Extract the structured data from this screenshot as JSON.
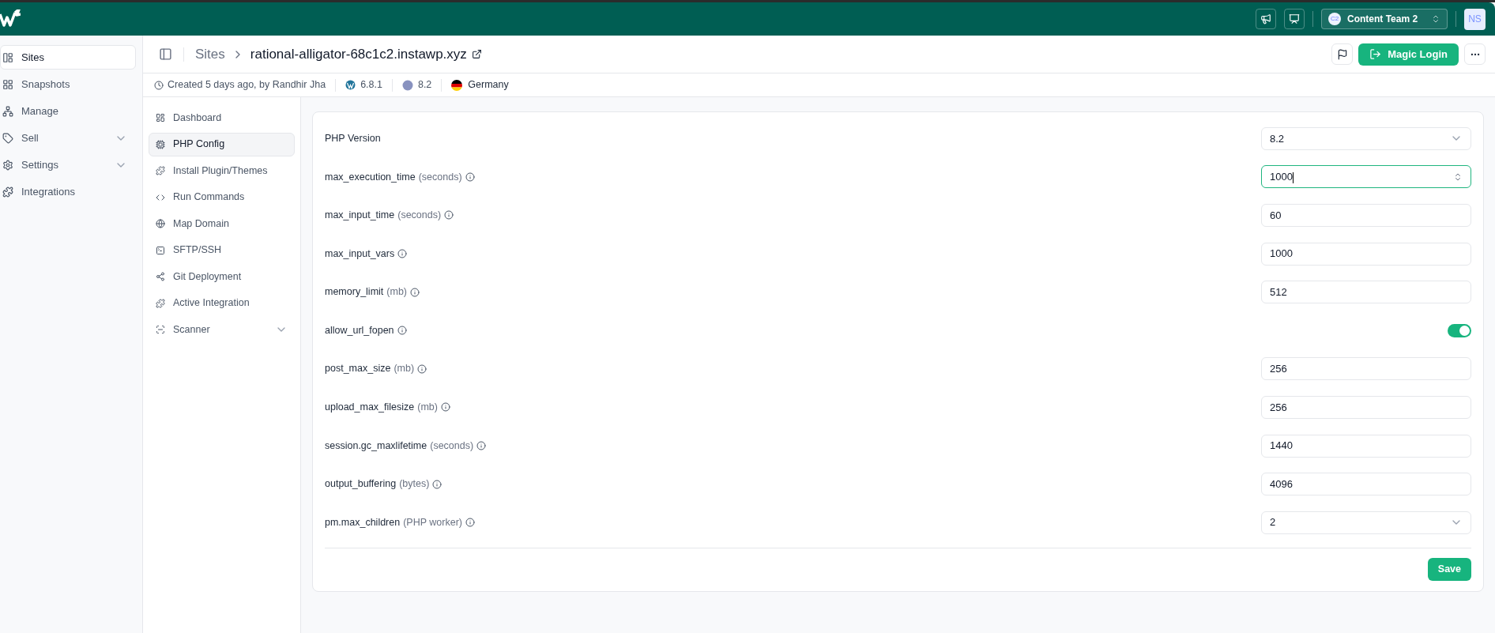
{
  "topbar": {
    "team": {
      "initials": "C2",
      "name": "Content Team 2"
    },
    "avatar": "NS"
  },
  "sidebar": {
    "items": [
      {
        "label": "Sites",
        "selected": true,
        "expandable": false
      },
      {
        "label": "Snapshots",
        "selected": false,
        "expandable": false
      },
      {
        "label": "Manage",
        "selected": false,
        "expandable": false
      },
      {
        "label": "Sell",
        "selected": false,
        "expandable": true
      },
      {
        "label": "Settings",
        "selected": false,
        "expandable": true
      },
      {
        "label": "Integrations",
        "selected": false,
        "expandable": false
      }
    ]
  },
  "header": {
    "breadcrumb": [
      "Sites",
      "rational-alligator-68c1c2.instawp.xyz"
    ],
    "magic_login": "Magic Login"
  },
  "meta": {
    "created": "Created 5 days ago, by Randhir Jha",
    "wp_version": "6.8.1",
    "php_version": "8.2",
    "country": "Germany"
  },
  "subnav": {
    "items": [
      {
        "label": "Dashboard",
        "selected": false,
        "expandable": false
      },
      {
        "label": "PHP Config",
        "selected": true,
        "expandable": false
      },
      {
        "label": "Install Plugin/Themes",
        "selected": false,
        "expandable": false
      },
      {
        "label": "Run Commands",
        "selected": false,
        "expandable": false
      },
      {
        "label": "Map Domain",
        "selected": false,
        "expandable": false
      },
      {
        "label": "SFTP/SSH",
        "selected": false,
        "expandable": false
      },
      {
        "label": "Git Deployment",
        "selected": false,
        "expandable": false
      },
      {
        "label": "Active Integration",
        "selected": false,
        "expandable": false
      },
      {
        "label": "Scanner",
        "selected": false,
        "expandable": true
      }
    ]
  },
  "form": {
    "fields": [
      {
        "kind": "select",
        "name": "PHP Version",
        "value": "8.2",
        "info": false
      },
      {
        "kind": "number",
        "name": "max_execution_time",
        "unit": "(seconds)",
        "value": "1000",
        "info": true,
        "focused": true
      },
      {
        "kind": "number",
        "name": "max_input_time",
        "unit": "(seconds)",
        "value": "60",
        "info": true,
        "focused": false
      },
      {
        "kind": "number",
        "name": "max_input_vars",
        "value": "1000",
        "info": true,
        "focused": false
      },
      {
        "kind": "number",
        "name": "memory_limit",
        "unit": "(mb)",
        "value": "512",
        "info": true,
        "focused": false
      },
      {
        "kind": "toggle",
        "name": "allow_url_fopen",
        "info": true,
        "on": true
      },
      {
        "kind": "number",
        "name": "post_max_size",
        "unit": "(mb)",
        "value": "256",
        "info": true,
        "focused": false
      },
      {
        "kind": "number",
        "name": "upload_max_filesize",
        "unit": "(mb)",
        "value": "256",
        "info": true,
        "focused": false
      },
      {
        "kind": "number",
        "name": "session.gc_maxlifetime",
        "unit": "(seconds)",
        "value": "1440",
        "info": true,
        "focused": false
      },
      {
        "kind": "number",
        "name": "output_buffering",
        "unit": "(bytes)",
        "value": "4096",
        "info": true,
        "focused": false
      },
      {
        "kind": "select",
        "name": "pm.max_children",
        "unit": "(PHP worker)",
        "value": "2",
        "info": true
      }
    ],
    "save": "Save"
  }
}
